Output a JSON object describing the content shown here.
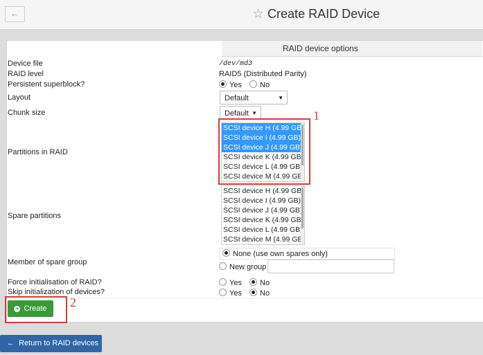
{
  "header": {
    "back_icon": "arrow-left-icon",
    "star_icon": "star-icon",
    "title": "Create RAID Device"
  },
  "panel": {
    "heading": "RAID device options"
  },
  "fields": {
    "device_file": {
      "label": "Device file",
      "value": "/dev/md3"
    },
    "raid_level": {
      "label": "RAID level",
      "value": "RAID5 (Distributed Parity)"
    },
    "superblock": {
      "label": "Persistent superblock?",
      "yes": "Yes",
      "no": "No",
      "selected": "Yes"
    },
    "layout": {
      "label": "Layout",
      "value": "Default"
    },
    "chunk": {
      "label": "Chunk size",
      "value": "Default"
    },
    "partitions": {
      "label": "Partitions in RAID",
      "options": [
        "SCSI device H (4.99 GB)",
        "SCSI device I (4.99 GB)",
        "SCSI device J (4.99 GB)",
        "SCSI device K (4.99 GB)",
        "SCSI device L (4.99 GB)",
        "SCSI device M (4.99 GB)"
      ],
      "selected": [
        0,
        1,
        2
      ]
    },
    "spares": {
      "label": "Spare partitions",
      "options": [
        "SCSI device H (4.99 GB)",
        "SCSI device I (4.99 GB)",
        "SCSI device J (4.99 GB)",
        "SCSI device K (4.99 GB)",
        "SCSI device L (4.99 GB)",
        "SCSI device M (4.99 GB)"
      ]
    },
    "spare_group": {
      "label": "Member of spare group",
      "none": "None (use own spares only)",
      "new": "New group",
      "selected": "none"
    },
    "force_init": {
      "label": "Force initialisation of RAID?",
      "yes": "Yes",
      "no": "No",
      "selected": "No"
    },
    "skip_init": {
      "label": "Skip initialization of devices?",
      "yes": "Yes",
      "no": "No",
      "selected": "No"
    }
  },
  "buttons": {
    "create": "Create",
    "return": "Return to RAID devices",
    "return_icon": "arrow-left-icon",
    "create_icon": "plus-circle-icon"
  },
  "annotations": {
    "one": "1",
    "two": "2",
    "color": "#d63b3b"
  }
}
